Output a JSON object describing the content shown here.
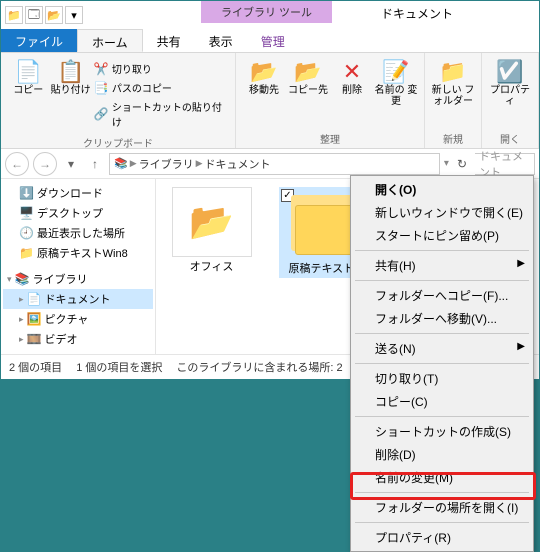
{
  "title_tool_tab": "ライブラリ ツール",
  "title": "ドキュメント",
  "tabs": {
    "file": "ファイル",
    "home": "ホーム",
    "share": "共有",
    "view": "表示",
    "manage": "管理"
  },
  "ribbon": {
    "copy": "コピー",
    "paste": "貼り付け",
    "cut": "切り取り",
    "copypath": "パスのコピー",
    "pasteshortcut": "ショートカットの貼り付け",
    "moveto": "移動先",
    "copyto": "コピー先",
    "delete": "削除",
    "rename": "名前の\n変更",
    "newfolder": "新しい\nフォルダー",
    "properties": "プロパティ",
    "group_clipboard": "クリップボード",
    "group_organize": "整理",
    "group_new": "新規",
    "group_open": "開く"
  },
  "breadcrumb": {
    "seg1": "ライブラリ",
    "seg2": "ドキュメント"
  },
  "search_placeholder": "ドキュメント",
  "tree": {
    "downloads": "ダウンロード",
    "desktop": "デスクトップ",
    "recent": "最近表示した場所",
    "genkou": "原稿テキストWin8",
    "libraries": "ライブラリ",
    "documents": "ドキュメント",
    "pictures": "ピクチャ",
    "videos": "ビデオ"
  },
  "items": {
    "office": "オフィス",
    "genkou": "原稿テキストW"
  },
  "status": {
    "count": "2 個の項目",
    "selected": "1 個の項目を選択",
    "library": "このライブラリに含まれる場所: 2"
  },
  "ctx": {
    "open": "開く(O)",
    "open_new": "新しいウィンドウで開く(E)",
    "pin_start": "スタートにピン留め(P)",
    "share": "共有(H)",
    "copy_folder": "フォルダーへコピー(F)...",
    "move_folder": "フォルダーへ移動(V)...",
    "send_to": "送る(N)",
    "cut": "切り取り(T)",
    "copy": "コピー(C)",
    "shortcut": "ショートカットの作成(S)",
    "delete": "削除(D)",
    "rename": "名前の変更(M)",
    "open_loc": "フォルダーの場所を開く(I)",
    "properties": "プロパティ(R)"
  }
}
